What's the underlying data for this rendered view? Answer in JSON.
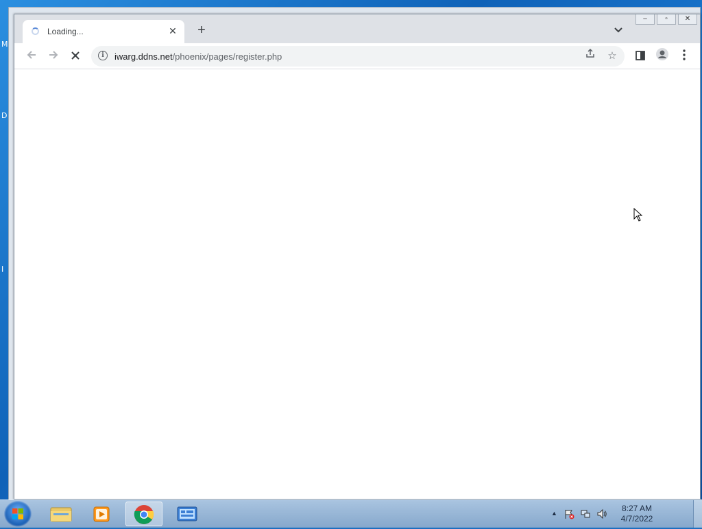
{
  "browser": {
    "tab": {
      "title": "Loading...",
      "close_icon": "close-icon"
    },
    "new_tab_symbol": "+",
    "address": {
      "host": "iwarg.ddns.net",
      "path": "/phoenix/pages/register.php"
    }
  },
  "taskbar": {
    "clock": {
      "time": "8:27 AM",
      "date": "4/7/2022"
    },
    "apps": [
      "windows-explorer",
      "media-player",
      "chrome",
      "control-panel"
    ]
  },
  "desktop": {
    "letters": [
      "M",
      "D",
      "I"
    ]
  },
  "colors": {
    "accent": "#1a73e8",
    "tabstrip": "#dee1e6",
    "taskbar": "#a9c4e0"
  }
}
